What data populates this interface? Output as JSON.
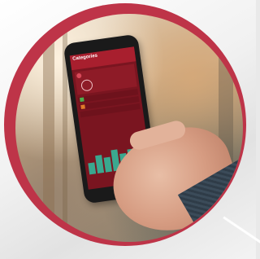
{
  "phone_app": {
    "title": "Categories",
    "subtitle": "",
    "card_title": ""
  }
}
